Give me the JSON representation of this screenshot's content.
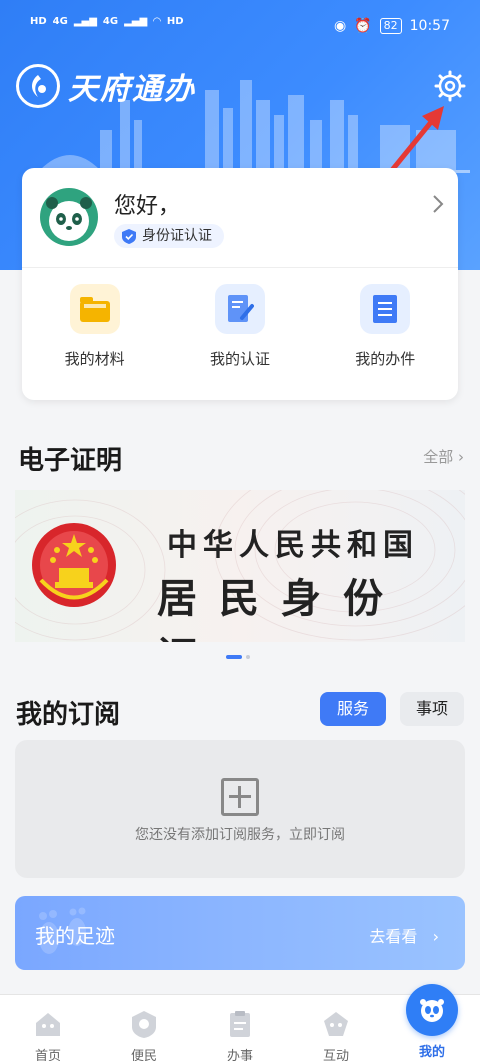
{
  "status_bar": {
    "sim1": "HD",
    "sim2": "HD",
    "net1": "4G",
    "net2": "4G",
    "battery": "82",
    "time": "10:57"
  },
  "app": {
    "name": "天府通办"
  },
  "profile": {
    "greeting": "您好，",
    "id_badge": "身份证认证"
  },
  "quick_actions": [
    {
      "label": "我的材料"
    },
    {
      "label": "我的认证"
    },
    {
      "label": "我的办件"
    }
  ],
  "ecert": {
    "title": "电子证明",
    "all_label": "全部",
    "card_line1": "中华人民共和国",
    "card_line2": "居民身份证"
  },
  "subscription": {
    "title": "我的订阅",
    "tabs": [
      "服务",
      "事项"
    ],
    "active_tab": "服务",
    "empty_hint": "您还没有添加订阅服务，立即订阅"
  },
  "footprint": {
    "title": "我的足迹",
    "link": "去看看"
  },
  "bottom_nav": [
    {
      "label": "首页"
    },
    {
      "label": "便民"
    },
    {
      "label": "办事"
    },
    {
      "label": "互动"
    },
    {
      "label": "我的"
    }
  ],
  "colors": {
    "primary": "#3f7af6",
    "header_start": "#2f7ef6",
    "annotation_arrow": "#e53935"
  }
}
